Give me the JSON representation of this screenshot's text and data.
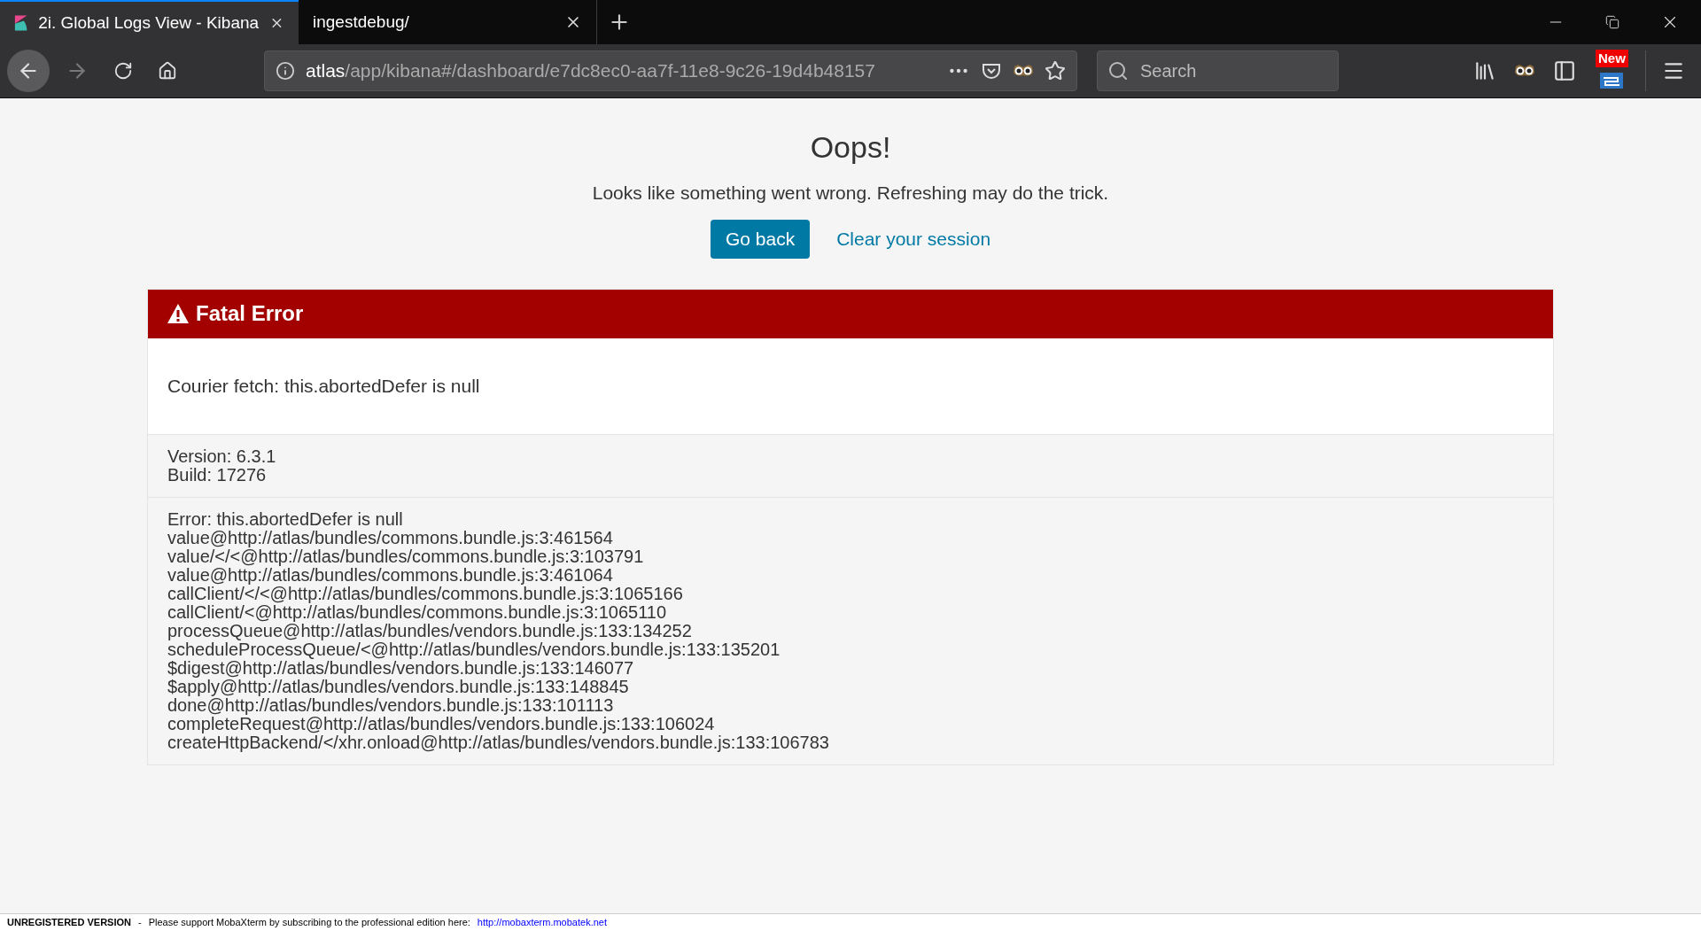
{
  "tabs": [
    {
      "title": "2i. Global Logs View - Kibana",
      "selected": true
    },
    {
      "title": "ingestdebug/",
      "selected": false
    }
  ],
  "address_bar": {
    "host": "atlas",
    "path": "/app/kibana#/dashboard/e7dc8ec0-aa7f-11e8-9c26-19d4b48157"
  },
  "search": {
    "placeholder": "Search"
  },
  "badge": "New",
  "error_page": {
    "title": "Oops!",
    "message": "Looks like something went wrong. Refreshing may do the trick.",
    "primary_button": "Go back",
    "link": "Clear your session",
    "panel_title": "Fatal Error",
    "error_message": "Courier fetch: this.abortedDefer is null",
    "version_lines": [
      "Version: 6.3.1",
      "Build: 17276"
    ],
    "stack_lines": [
      "Error: this.abortedDefer is null",
      "value@http://atlas/bundles/commons.bundle.js:3:461564",
      "value/</<@http://atlas/bundles/commons.bundle.js:3:103791",
      "value@http://atlas/bundles/commons.bundle.js:3:461064",
      "callClient/</<@http://atlas/bundles/commons.bundle.js:3:1065166",
      "callClient/<@http://atlas/bundles/commons.bundle.js:3:1065110",
      "processQueue@http://atlas/bundles/vendors.bundle.js:133:134252",
      "scheduleProcessQueue/<@http://atlas/bundles/vendors.bundle.js:133:135201",
      "$digest@http://atlas/bundles/vendors.bundle.js:133:146077",
      "$apply@http://atlas/bundles/vendors.bundle.js:133:148845",
      "done@http://atlas/bundles/vendors.bundle.js:133:101113",
      "completeRequest@http://atlas/bundles/vendors.bundle.js:133:106024",
      "createHttpBackend/</xhr.onload@http://atlas/bundles/vendors.bundle.js:133:106783"
    ]
  },
  "footer": {
    "label": "UNREGISTERED VERSION",
    "separator": "-",
    "text": "Please support MobaXterm by subscribing to the professional edition here:",
    "link": "http://mobaxterm.mobatek.net"
  }
}
